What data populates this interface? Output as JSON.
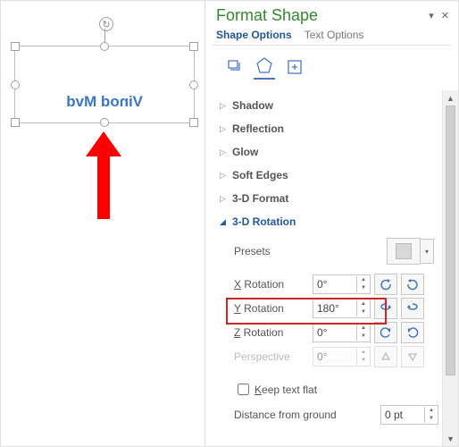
{
  "canvas": {
    "mirrored_text": "Vinod Mvd"
  },
  "panel": {
    "title": "Format Shape",
    "tabs": {
      "shape_options": "Shape Options",
      "text_options": "Text Options"
    },
    "sections": {
      "shadow": "Shadow",
      "reflection": "Reflection",
      "glow": "Glow",
      "soft_edges": "Soft Edges",
      "format3d": "3-D Format",
      "rotation3d": "3-D Rotation"
    },
    "rotation": {
      "presets_label": "Presets",
      "x_label": "X Rotation",
      "y_label": "Y Rotation",
      "z_label": "Z Rotation",
      "perspective_label": "Perspective",
      "x_value": "0°",
      "y_value": "180°",
      "z_value": "0°",
      "perspective_value": "0°",
      "keep_flat": "Keep text flat",
      "distance_label": "Distance from ground",
      "distance_value": "0 pt"
    }
  }
}
